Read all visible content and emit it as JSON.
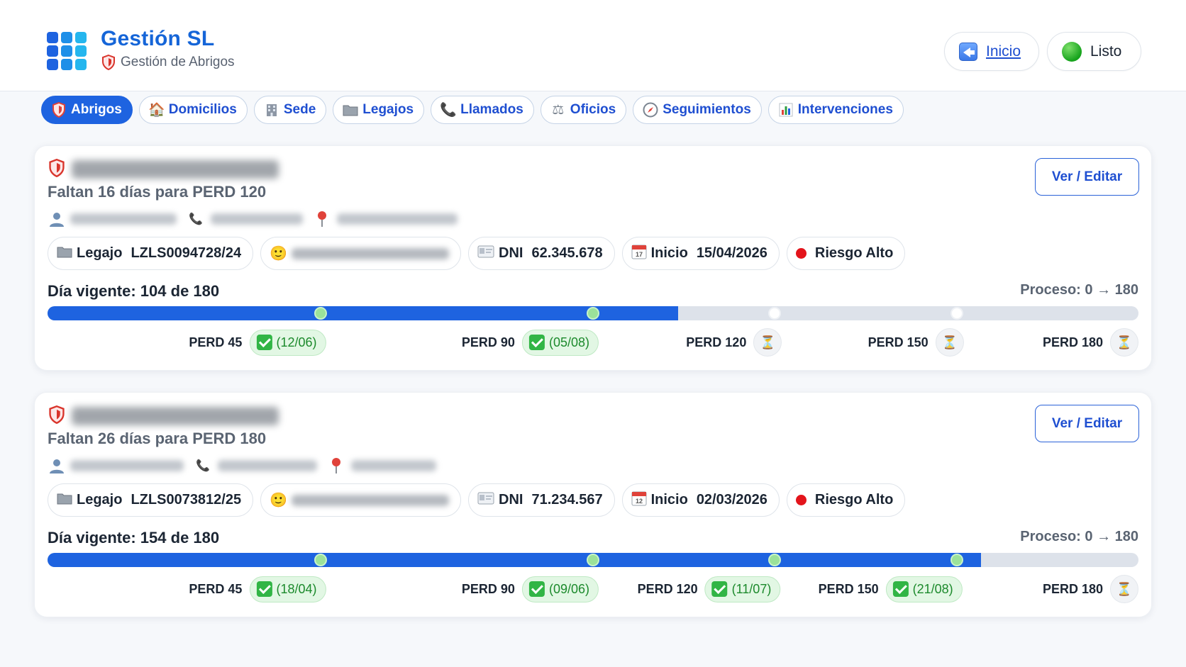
{
  "header": {
    "title": "Gestión SL",
    "subtitle": "Gestión de Abrigos",
    "logo_colors": [
      "#1e63e0",
      "#1e8fe8",
      "#25b6ee"
    ],
    "inicio_label": "Inicio",
    "status_label": "Listo"
  },
  "tabs": [
    {
      "label": "Abrigos",
      "icon": "shield-icon",
      "active": true
    },
    {
      "label": "Domicilios",
      "icon": "house-icon",
      "active": false
    },
    {
      "label": "Sede",
      "icon": "building-icon",
      "active": false
    },
    {
      "label": "Legajos",
      "icon": "folder-icon",
      "active": false
    },
    {
      "label": "Llamados",
      "icon": "phone-icon",
      "active": false
    },
    {
      "label": "Oficios",
      "icon": "scales-icon",
      "active": false
    },
    {
      "label": "Seguimientos",
      "icon": "compass-icon",
      "active": false
    },
    {
      "label": "Intervenciones",
      "icon": "bar-chart-icon",
      "active": false
    }
  ],
  "colors": {
    "accent": "#1e63e0",
    "track": "#dde2ea",
    "risk_high": "#e3141b",
    "done_badge": "#e2f7e4"
  },
  "cards": [
    {
      "remaining": "Faltan 16 días para PERD 120",
      "edit_label": "Ver / Editar",
      "legajo_key": "Legajo",
      "legajo_value": "LZLS0094728/24",
      "dni_key": "DNI",
      "dni_value": "62.345.678",
      "inicio_key": "Inicio",
      "inicio_value": "15/04/2026",
      "risk_label": "Riesgo Alto",
      "day_label": "Día vigente: 104 de 180",
      "process_label": "Proceso: 0 → 180",
      "day_current": 104,
      "day_total": 180,
      "milestones": [
        {
          "label": "PERD 45",
          "day": 45,
          "done": true,
          "date": "(12/06)"
        },
        {
          "label": "PERD 90",
          "day": 90,
          "done": true,
          "date": "(05/08)"
        },
        {
          "label": "PERD 120",
          "day": 120,
          "done": false,
          "date": ""
        },
        {
          "label": "PERD 150",
          "day": 150,
          "done": false,
          "date": ""
        },
        {
          "label": "PERD 180",
          "day": 180,
          "done": false,
          "date": ""
        }
      ]
    },
    {
      "remaining": "Faltan 26 días para PERD 180",
      "edit_label": "Ver / Editar",
      "legajo_key": "Legajo",
      "legajo_value": "LZLS0073812/25",
      "dni_key": "DNI",
      "dni_value": "71.234.567",
      "inicio_key": "Inicio",
      "inicio_value": "02/03/2026",
      "risk_label": "Riesgo Alto",
      "day_label": "Día vigente: 154 de 180",
      "process_label": "Proceso: 0 → 180",
      "day_current": 154,
      "day_total": 180,
      "milestones": [
        {
          "label": "PERD 45",
          "day": 45,
          "done": true,
          "date": "(18/04)"
        },
        {
          "label": "PERD 90",
          "day": 90,
          "done": true,
          "date": "(09/06)"
        },
        {
          "label": "PERD 120",
          "day": 120,
          "done": true,
          "date": "(11/07)"
        },
        {
          "label": "PERD 150",
          "day": 150,
          "done": true,
          "date": "(21/08)"
        },
        {
          "label": "PERD 180",
          "day": 180,
          "done": false,
          "date": ""
        }
      ]
    }
  ]
}
